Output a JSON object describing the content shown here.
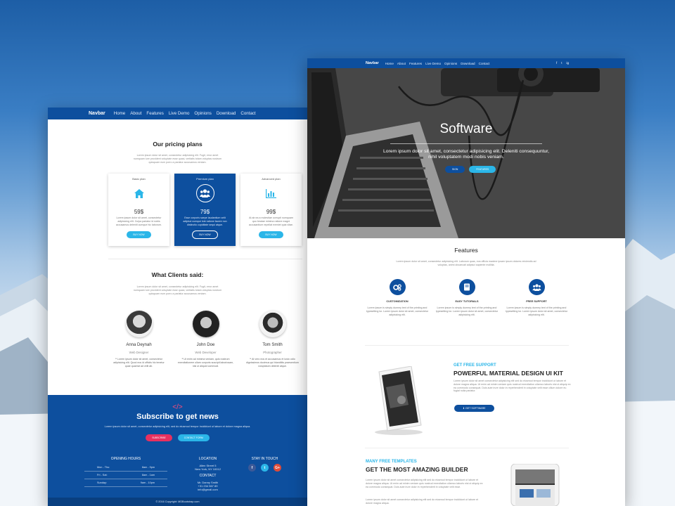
{
  "left_page": {
    "nav": {
      "brand": "Navbar",
      "links": [
        "Home",
        "About",
        "Features",
        "Live Demo",
        "Opinions",
        "Download",
        "Contact"
      ]
    },
    "pricing": {
      "title": "Our pricing plans",
      "intro": "Lorem ipsum dolor sit amet, consectetur adipisicing elit. Fugit, error amet numquam iure provident voluptate esse quasi, veritatis totam voluptas nostrum quisquam eum porro a pariatur accusamus veniam.",
      "plans": [
        {
          "name": "Basic plan",
          "icon": "home-icon",
          "price": "59$",
          "desc": "Lorem ipsum dolor sit amet, consectetur adipisicing elit. Culpa pariatur id nobis accusamus deleniti cumque hic laborum.",
          "button": "BUY NOW"
        },
        {
          "name": "Premium plan",
          "icon": "users-icon",
          "price": "79$",
          "desc": "Esse corporis saepe laudantium velit adipisci cumque iste ratione facere non distinctio cupiditate sequi atque.",
          "button": "BUY NOW"
        },
        {
          "name": "Advanced plan",
          "icon": "chart-icon",
          "price": "99$",
          "desc": "At ab ea a molestiae corrupti numquam quo beatae minima ratione magni accusantium repellat eveniet quia vitae.",
          "button": "BUY NOW"
        }
      ]
    },
    "clients": {
      "title": "What Clients said:",
      "intro": "Lorem ipsum dolor sit amet, consectetur adipisicing elit. Fugit, error amet numquam iure provident voluptate esse quasi, veritatis totam voluptas nostrum quisquam eum porro a pariatur accusamus veniam.",
      "items": [
        {
          "name": "Anna Deynah",
          "role": "Web Designer",
          "quote": "❝ Lorem ipsum dolor sit amet, consectetur adipisicing elit. Quod eos id officiis hic tenetur quae quaerat ad velit ab."
        },
        {
          "name": "John Doe",
          "role": "Web Developer",
          "quote": "❝ Ut enim ad minima veniam, quis nostrum exercitationem ullam corporis suscipit laboriosam, nisi ut aliquid commodi."
        },
        {
          "name": "Tom Smith",
          "role": "Photographer",
          "quote": "❝ At vero eos et accusamus et iusto odio dignissimos ducimus qui blanditiis praesentium voluptatum deleniti atque."
        }
      ]
    },
    "subscribe": {
      "title": "Subscribe to get news",
      "desc": "Lorem ipsum dolor sit amet, consectetur adipisicing elit, sed do eiusmod tempor incididunt ut labore et dolore magna aliqua.",
      "btn_primary": "SUBSCRIBE",
      "btn_secondary": "CONTACT FORM"
    },
    "footer": {
      "hours_title": "OPENING HOURS",
      "hours": [
        {
          "day": "Mon - Thu:",
          "time": "8am - 9pm"
        },
        {
          "day": "Fri - Sat:",
          "time": "8am - 1am"
        },
        {
          "day": "Sunday:",
          "time": "9am - 10pm"
        }
      ],
      "location_title": "LOCATION",
      "location_l1": "Allen Street 5",
      "location_l2": "New York, NY 10012",
      "contact_title": "CONTACT",
      "contact_l1": "Mr. Danny Smith",
      "contact_l2": "+31 234 567 89",
      "contact_l3": "info@gmail.com",
      "touch_title": "STAY IN TOUCH",
      "socials": [
        "f",
        "t",
        "G+"
      ],
      "copyright": "© 2016 Copyright: MDBootstrap.com"
    }
  },
  "right_page": {
    "nav": {
      "brand": "Navbar",
      "links": [
        "Home",
        "About",
        "Features",
        "Live Demo",
        "Opinions",
        "Download",
        "Contact"
      ],
      "socials": [
        "f",
        "t",
        "ig"
      ]
    },
    "hero": {
      "title": "Software",
      "subtitle_l1": "Lorem ipsum dolor sit amet, consectetur adipisicing elit. Deleniti consequuntur,",
      "subtitle_l2": "nihil voluptatem modi nobis veniam.",
      "btn_primary": "SIGN",
      "btn_secondary": "FEATURES"
    },
    "features": {
      "title": "Features",
      "intro": "Lorem ipsum dolor sit amet, consectetur adipisicing elit. Laborum quas, eos officia maxime ipsam ipsum dolores reiciendis ad voluptas, animi obcaecati adipisci sapiente mollitia.",
      "items": [
        {
          "name": "CUSTOMIZATION",
          "icon": "gears-icon",
          "desc": "Lorem ipsum is simply dummy text of the printing and typesetting lor. Lorem ipsum dolor sit amet, consectetur adipisicing elit."
        },
        {
          "name": "EASY TUTORIALS",
          "icon": "book-icon",
          "desc": "Lorem ipsum is simply dummy text of the printing and typesetting lor. Lorem ipsum dolor sit amet, consectetur adipisicing elit."
        },
        {
          "name": "FREE SUPPORT",
          "icon": "users-icon",
          "desc": "Lorem ipsum is simply dummy text of the printing and typesetting lor. Lorem ipsum dolor sit amet, consectetur adipisicing elit."
        }
      ]
    },
    "support": {
      "kicker": "GET FREE SUPPORT",
      "title": "POWERFUL MATERIAL DESIGN UI KIT",
      "text": "Lorem ipsum dolor sit amet consectetur adipisicing elit sed do eiusmod tempor incididunt ut labore et dolore magna aliqua. Ut enim ad minim veniam quis nostrud exercitation ullamco laboris nisi ut aliquip ex ea commodo consequat. Duis aute irure dolor in reprehenderit in voluptate velit esse cillum dolore eu fugiat nulla pariatur.",
      "button": "GET SOFTWARE"
    },
    "templates": {
      "kicker": "MANY FREE TEMPLATES",
      "title": "GET THE MOST AMAZING BUILDER",
      "text": "Lorem ipsum dolor sit amet consectetur adipisicing elit sed do eiusmod tempor incididunt ut labore et dolore magna aliqua. Ut enim ad minim veniam quis nostrud exercitation ullamco laboris nisi ut aliquip ex ea commodo consequat. Duis aute irure dolor in reprehenderit in voluptate velit esse.",
      "text2": "Lorem ipsum dolor sit amet consectetur adipisicing elit sed do eiusmod tempor incididunt ut labore et dolore magna aliqua."
    }
  },
  "colors": {
    "primary": "#0d4f9e",
    "accent": "#2bb6e8",
    "pink": "#e8305f"
  }
}
